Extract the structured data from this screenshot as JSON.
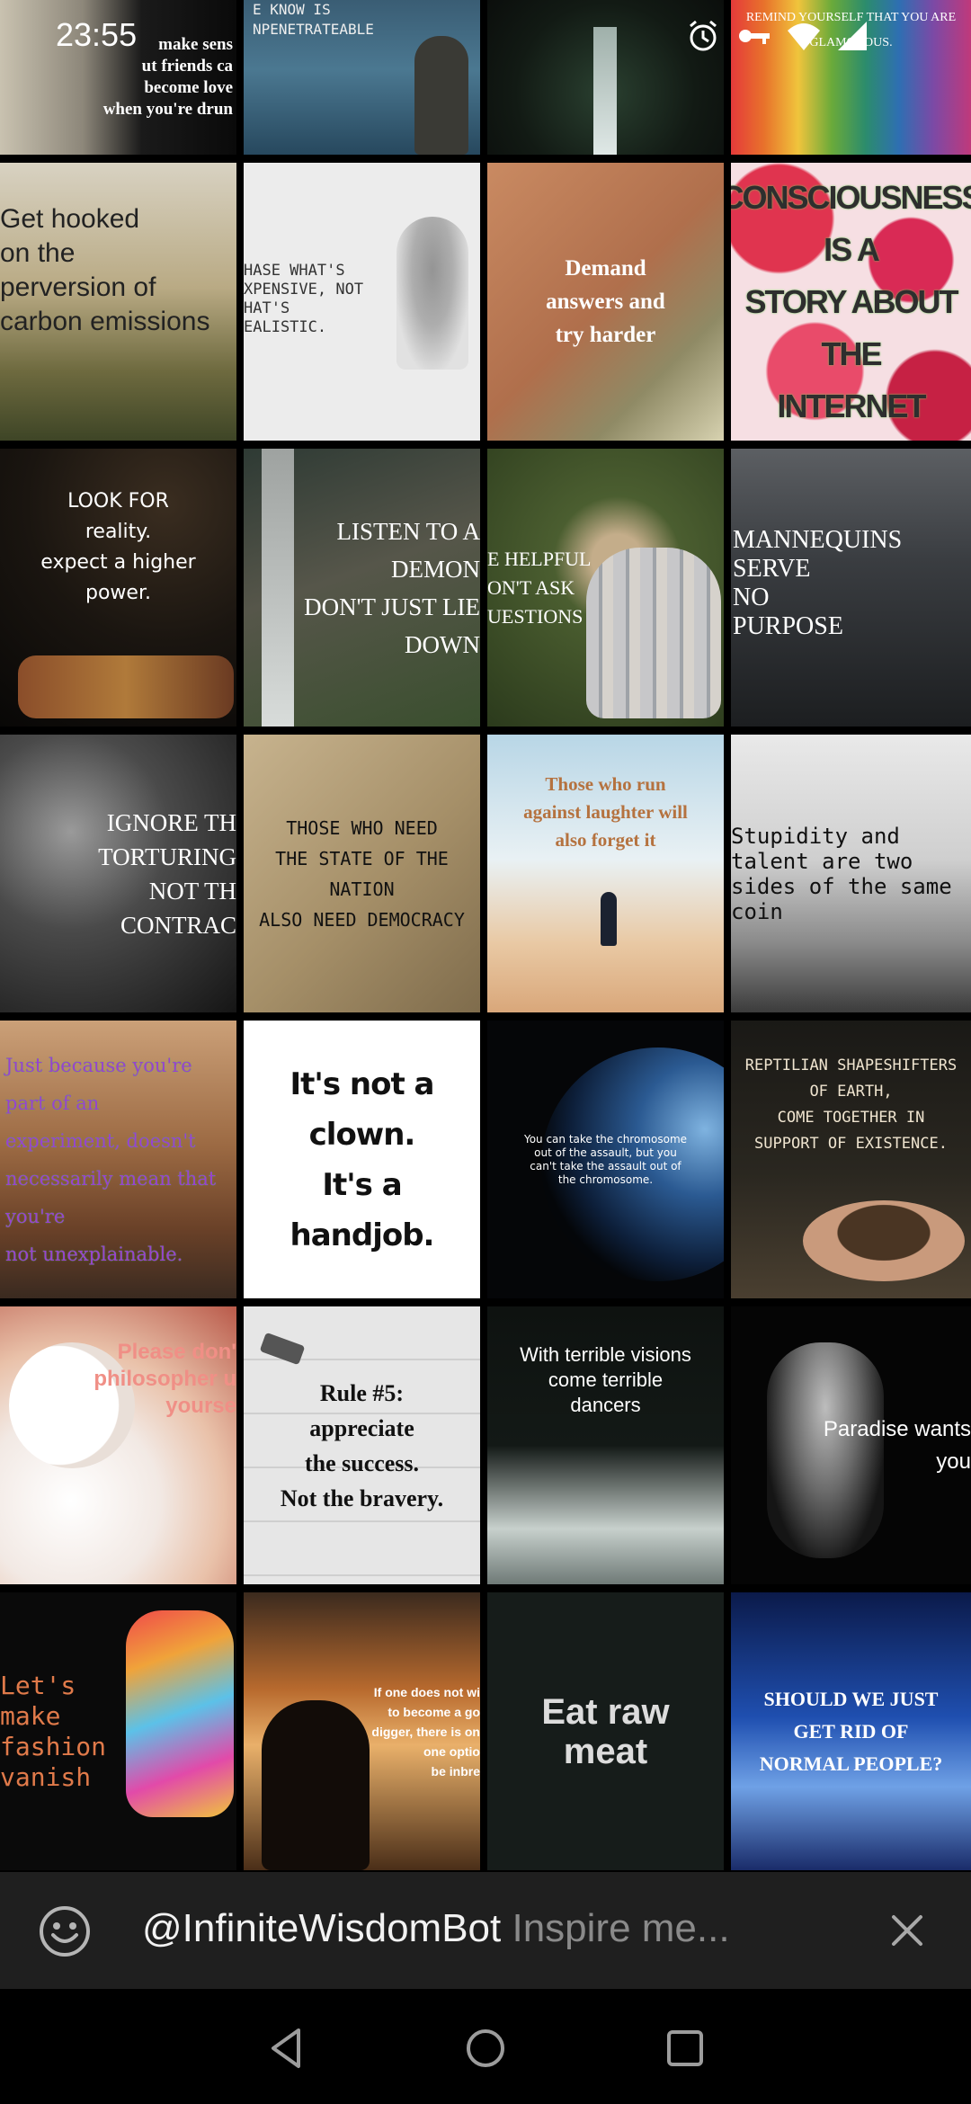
{
  "status_bar": {
    "time": "23:55",
    "icons": [
      "alarm-icon",
      "key-icon",
      "wifi-icon",
      "signal-icon"
    ]
  },
  "tiles": [
    {
      "id": "t1",
      "caption": "make sens\nut friends ca\nbecome love\nwhen you're drun"
    },
    {
      "id": "t2",
      "caption": "E KNOW IS\nNPENETRATEABLE"
    },
    {
      "id": "t3",
      "caption": ""
    },
    {
      "id": "t4",
      "caption": "REMIND YOURSELF THAT YOU ARE\nGLAMOROUS."
    },
    {
      "id": "t5",
      "caption": "Get hooked\non the\nperversion of\ncarbon emissions"
    },
    {
      "id": "t6",
      "caption": "HASE WHAT'S\nXPENSIVE, NOT\nHAT'S\nEALISTIC."
    },
    {
      "id": "t7",
      "caption": "Demand\nanswers and\ntry harder"
    },
    {
      "id": "t8",
      "caption": "CONSCIOUSNESS IS A\nSTORY ABOUT THE\nINTERNET"
    },
    {
      "id": "t9",
      "caption": "LOOK FOR\nreality.\nexpect a higher power."
    },
    {
      "id": "t10",
      "caption": "LISTEN TO A DEMON\nDON'T JUST LIE DOWN"
    },
    {
      "id": "t11",
      "caption": "E HELPFUL\nON'T ASK\nUESTIONS"
    },
    {
      "id": "t12",
      "caption": "MANNEQUINS\nSERVE\nNO\nPURPOSE"
    },
    {
      "id": "t13",
      "caption": "IGNORE TH\nTORTURING\nNOT TH\nCONTRAC"
    },
    {
      "id": "t14",
      "caption": "THOSE WHO NEED\nTHE STATE OF THE\nNATION\nALSO NEED DEMOCRACY"
    },
    {
      "id": "t15",
      "caption": "Those who run\nagainst laughter will\nalso forget it"
    },
    {
      "id": "t16",
      "caption": "Stupidity and\ntalent are two\nsides of the same coin"
    },
    {
      "id": "t17",
      "caption": "Just because you're part of an\nexperiment, doesn't\nnecessarily mean that you're\nnot unexplainable."
    },
    {
      "id": "t18",
      "caption": "It's not a clown.\nIt's a handjob."
    },
    {
      "id": "t19",
      "caption": "You can take the chromosome\nout of the assault, but you\ncan't take the assault out of\nthe chromosome."
    },
    {
      "id": "t20",
      "caption": "REPTILIAN SHAPESHIFTERS\nOF EARTH,\nCOME TOGETHER IN\nSUPPORT OF EXISTENCE."
    },
    {
      "id": "t21",
      "caption": "Please don'\nphilosopher u\nyourse"
    },
    {
      "id": "t22",
      "caption": "Rule #5:\nappreciate\nthe success.\nNot the bravery."
    },
    {
      "id": "t23",
      "caption": "With terrible visions\ncome terrible\ndancers"
    },
    {
      "id": "t24",
      "caption": "Paradise wants\nyou"
    },
    {
      "id": "t25",
      "caption": "Let's\nmake\nfashion\nvanish"
    },
    {
      "id": "t26",
      "caption": "If one does not wi\nto become a go\ndigger, there is on\none optio\nbe inbre"
    },
    {
      "id": "t27",
      "caption": "Eat raw\nmeat"
    },
    {
      "id": "t28",
      "caption": "SHOULD WE JUST\nGET RID OF\nNORMAL PEOPLE?"
    }
  ],
  "input_bar": {
    "handle": "@InfiniteWisdomBot",
    "placeholder": "Inspire me...",
    "left_icon": "emoji-icon",
    "right_icon": "close-icon"
  },
  "nav_bar": {
    "icons": [
      "back-icon",
      "home-icon",
      "recents-icon"
    ]
  }
}
